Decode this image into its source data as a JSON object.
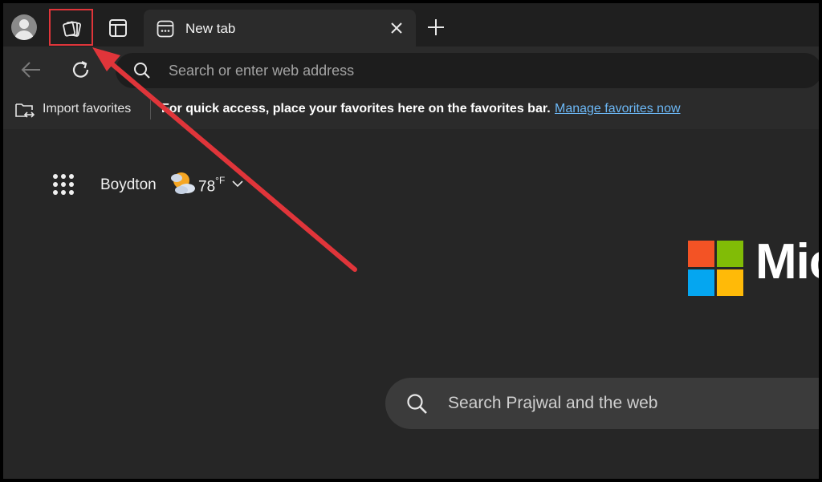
{
  "tabstrip": {
    "tab_title": "New tab"
  },
  "toolbar": {
    "address_placeholder": "Search or enter web address"
  },
  "favorites_bar": {
    "import_label": "Import favorites",
    "message": "For quick access, place your favorites here on the favorites bar.",
    "manage_link": "Manage favorites now"
  },
  "weather": {
    "city": "Boydton",
    "temperature": "78",
    "unit": "°F"
  },
  "brand": {
    "wordmark_visible": "Mic",
    "logo_colors": [
      "#f35325",
      "#81bc06",
      "#05a6f0",
      "#ffba08"
    ]
  },
  "search": {
    "placeholder": "Search Prajwal and the web"
  },
  "annotation": {
    "highlight_color": "#e0353a",
    "arrow_color": "#e0353a"
  }
}
